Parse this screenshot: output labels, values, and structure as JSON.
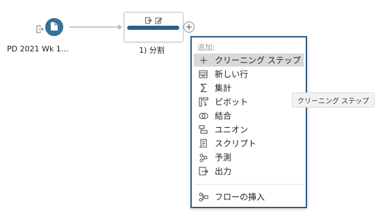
{
  "canvas": {
    "input_node": {
      "label": "PD 2021 Wk 1...",
      "icon": "document-icon",
      "accent": "#3a6f96"
    },
    "step_node": {
      "label": "1) 分割",
      "bar_color": "#2f5f86"
    },
    "add_button": {
      "label": "+"
    }
  },
  "menu": {
    "header": "追加:",
    "items": [
      {
        "label": "クリーニング ステップ",
        "icon": "plus-icon"
      },
      {
        "label": "新しい行",
        "icon": "new-rows-icon"
      },
      {
        "label": "集計",
        "icon": "sigma-icon"
      },
      {
        "label": "ピボット",
        "icon": "pivot-icon"
      },
      {
        "label": "結合",
        "icon": "join-icon"
      },
      {
        "label": "ユニオン",
        "icon": "union-icon"
      },
      {
        "label": "スクリプト",
        "icon": "script-icon"
      },
      {
        "label": "予測",
        "icon": "predict-icon"
      },
      {
        "label": "出力",
        "icon": "output-icon"
      }
    ],
    "footer_item": {
      "label": "フローの挿入",
      "icon": "insert-flow-icon"
    },
    "border_color": "#2d5c88"
  },
  "tooltip": {
    "text": "クリーニング ステップ"
  }
}
